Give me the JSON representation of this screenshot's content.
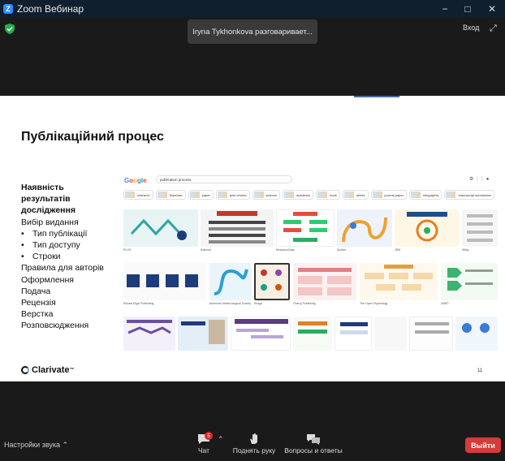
{
  "window": {
    "title": "Zoom Вебинар",
    "controls": [
      "−",
      "□",
      "✕"
    ]
  },
  "top": {
    "speaker_banner": "Iryna Tykhonkova разговаривает...",
    "exit_fullscreen": "Вход"
  },
  "slide": {
    "title": "Публікаційний процес",
    "outline_bold": [
      "Наявність",
      "результатів",
      "дослідження"
    ],
    "outline_items": [
      {
        "text": "Вибір видання",
        "bullet": false
      },
      {
        "text": "Тип публікації",
        "bullet": true
      },
      {
        "text": "Тип доступу",
        "bullet": true
      },
      {
        "text": "Строки",
        "bullet": true
      },
      {
        "text": "Правила для авторів",
        "bullet": false
      },
      {
        "text": "Оформлення",
        "bullet": false
      },
      {
        "text": "Подача",
        "bullet": false
      },
      {
        "text": "Рецензія",
        "bullet": false
      },
      {
        "text": "Верстка",
        "bullet": false
      },
      {
        "text": "Розповсюдження",
        "bullet": false
      }
    ],
    "bullet_char": "•",
    "brand": "Clarivate",
    "brand_tm": "™",
    "page_number": "11",
    "google": {
      "logo": "Google",
      "query": "publication process",
      "chips": [
        "research",
        "flowchart",
        "paper",
        "peer review",
        "science",
        "academic",
        "book",
        "article",
        "journal paper",
        "infographic",
        "manuscript submission"
      ],
      "captions_row1": [
        "PLOS",
        "Editorial",
        "ResearchGate",
        "Scribbr",
        "JRM",
        "Wiley"
      ],
      "captions_row2": [
        "Edvard Elgar Publishing",
        "American Meteorological Society",
        "Enago",
        "Cherry Publishing",
        "The Open Psychology",
        "UNEP"
      ],
      "captions_row3": [
        "",
        "",
        "",
        "",
        "",
        ""
      ]
    }
  },
  "bottom": {
    "audio_settings": "Настройки звука",
    "chat": "Чат",
    "chat_badge": "5",
    "raise_hand": "Поднять руку",
    "qa": "Вопросы и ответы",
    "leave": "Выйти"
  },
  "colors": {
    "leave": "#d63a3a",
    "badge": "#e02828",
    "titlebar": "#0f1f2e",
    "zoom_blue": "#2d8cff"
  }
}
